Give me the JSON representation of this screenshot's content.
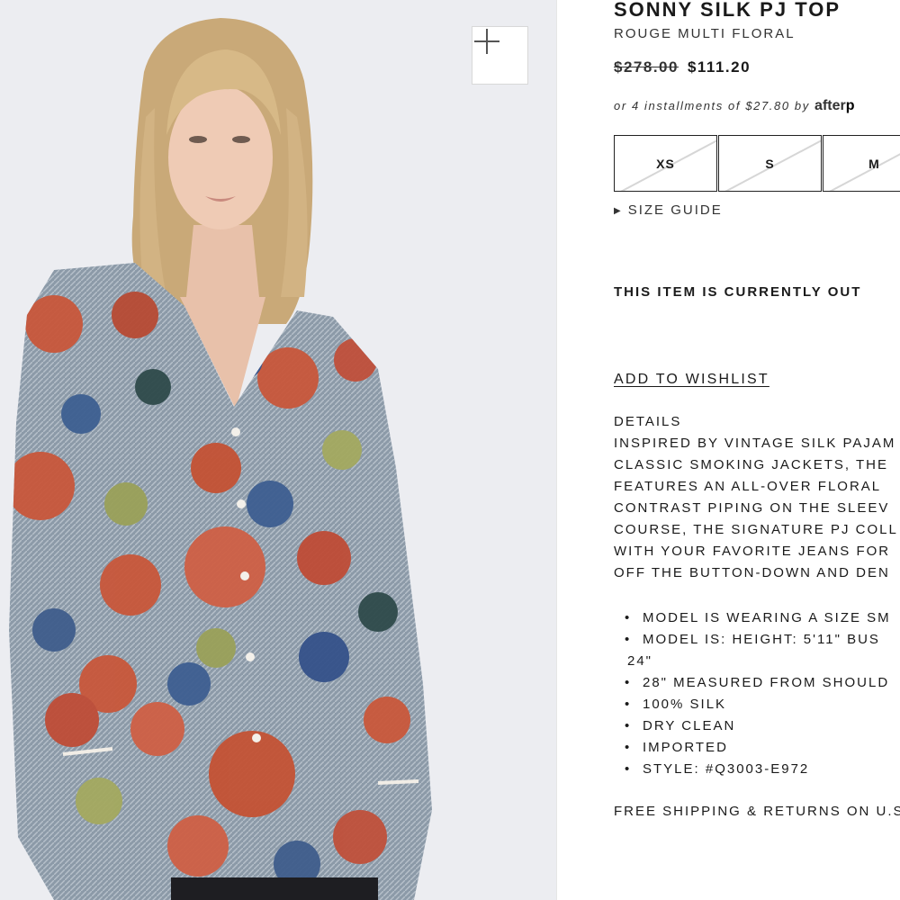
{
  "product": {
    "title": "SONNY SILK PJ TOP",
    "color": "ROUGE MULTI FLORAL",
    "price_original": "$278.00",
    "price_sale": "$111.20",
    "installments_text": "or 4 installments of $27.80 by",
    "installments_brand_light": "after",
    "installments_brand_bold": "p"
  },
  "sizes": [
    "XS",
    "S",
    "M"
  ],
  "size_guide_label": "SIZE GUIDE",
  "stock_message": "THIS ITEM IS CURRENTLY OUT",
  "wishlist_label": "ADD TO WISHLIST",
  "details": {
    "heading": "DETAILS",
    "lines": [
      "INSPIRED BY VINTAGE SILK PAJAM",
      "CLASSIC SMOKING JACKETS, THE",
      "FEATURES AN ALL-OVER FLORAL",
      "CONTRAST PIPING ON THE SLEEV",
      "COURSE, THE SIGNATURE PJ COLL",
      "WITH YOUR FAVORITE JEANS FOR",
      "OFF THE BUTTON-DOWN AND DEN"
    ],
    "bullets": [
      "MODEL IS WEARING A SIZE SM",
      "MODEL IS: HEIGHT: 5'11\" BUS",
      "24\"",
      "28\" MEASURED FROM SHOULD",
      "100% SILK",
      "DRY CLEAN",
      "IMPORTED",
      "STYLE: #Q3003-E972"
    ]
  },
  "shipping_text": "FREE SHIPPING & RETURNS ON U.S",
  "icons": {
    "zoom": "plus-icon",
    "size_guide": "caret-right-icon"
  },
  "colors": {
    "accent": "#1a1a1a",
    "image_bg": "#ecedf1",
    "border": "#222222"
  }
}
